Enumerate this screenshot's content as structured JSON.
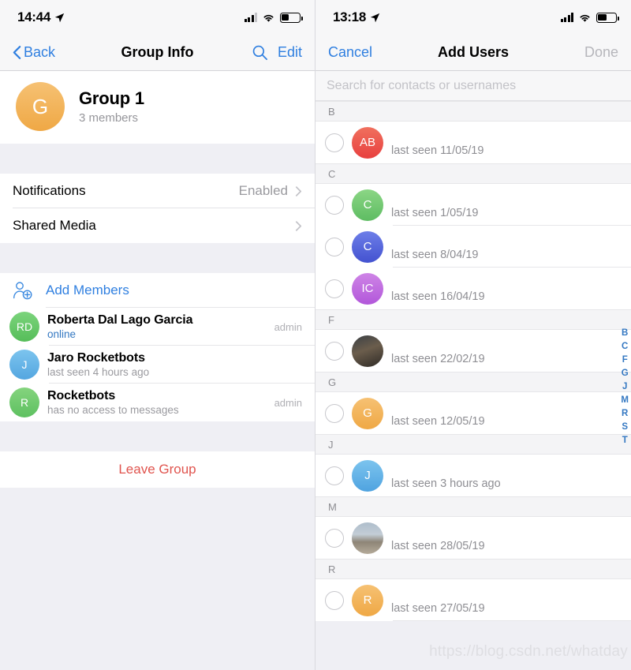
{
  "colors": {
    "accent_blue": "#2F7FE0",
    "index_blue": "#3478C2",
    "destructive_red": "#E0544E",
    "group_avatar": "#F2B156",
    "panel_bg": "#EFEFF4",
    "nav_bg": "#F7F7F8"
  },
  "left": {
    "status": {
      "time": "14:44",
      "location_icon": "location-arrow",
      "signal_bars": 2,
      "wifi_icon": "wifi",
      "battery_icon": "battery-half"
    },
    "nav": {
      "back_label": "Back",
      "back_icon": "chevron-left-icon",
      "title": "Group Info",
      "search_icon": "search-icon",
      "edit_label": "Edit"
    },
    "group": {
      "avatar_initial": "G",
      "avatar_color": "#F2B156",
      "name": "Group 1",
      "members_count": "3 members"
    },
    "settings": [
      {
        "label": "Notifications",
        "value": "Enabled",
        "chevron": "chevron-right-icon"
      },
      {
        "label": "Shared Media",
        "value": "",
        "chevron": "chevron-right-icon"
      }
    ],
    "add_members": {
      "icon": "add-person-icon",
      "label": "Add Members"
    },
    "members": [
      {
        "initials": "RD",
        "color": "#63C766",
        "name": "Roberta Dal Lago Garcia",
        "status": "online",
        "status_type": "online",
        "badge": "admin"
      },
      {
        "initials": "J",
        "color": "#63B3E8",
        "name": "Jaro Rocketbots",
        "status": "last seen 4 hours ago",
        "status_type": "offline",
        "badge": ""
      },
      {
        "initials": "R",
        "color": "#6DC96A",
        "name": "Rocketbots",
        "status": "has no access to messages",
        "status_type": "offline",
        "badge": "admin"
      }
    ],
    "leave_label": "Leave Group"
  },
  "right": {
    "status": {
      "time": "13:18",
      "location_icon": "location-arrow",
      "signal_bars": 4,
      "wifi_icon": "wifi",
      "battery_icon": "battery-half"
    },
    "nav": {
      "cancel_label": "Cancel",
      "title": "Add Users",
      "done_label": "Done"
    },
    "search": {
      "placeholder": "Search for contacts or usernames",
      "value": ""
    },
    "sections": [
      {
        "letter": "B",
        "contacts": [
          {
            "avatar_type": "initials",
            "initials": "AB",
            "color": "#EE5F55",
            "name": "",
            "subtitle": "last seen 11/05/19",
            "checked": false
          }
        ]
      },
      {
        "letter": "C",
        "contacts": [
          {
            "avatar_type": "initials",
            "initials": "C",
            "color": "#73C96E",
            "name": "",
            "subtitle": "last seen 1/05/19",
            "checked": false
          },
          {
            "avatar_type": "initials",
            "initials": "C",
            "color": "#5566DE",
            "name": "",
            "subtitle": "last seen 8/04/19",
            "checked": false
          },
          {
            "avatar_type": "initials",
            "initials": "IC",
            "color": "#C06BE0",
            "name": "",
            "subtitle": "last seen 16/04/19",
            "checked": false
          }
        ]
      },
      {
        "letter": "F",
        "contacts": [
          {
            "avatar_type": "photo",
            "photo_style": "photo-a",
            "initials": "",
            "color": "",
            "name": "",
            "subtitle": "last seen 22/02/19",
            "checked": false
          }
        ]
      },
      {
        "letter": "G",
        "contacts": [
          {
            "avatar_type": "initials",
            "initials": "G",
            "color": "#F2B156",
            "name": "",
            "subtitle": "last seen 12/05/19",
            "checked": false
          }
        ]
      },
      {
        "letter": "J",
        "contacts": [
          {
            "avatar_type": "initials",
            "initials": "J",
            "color": "#62B2E8",
            "name": "",
            "subtitle": "last seen 3 hours ago",
            "checked": false
          }
        ]
      },
      {
        "letter": "M",
        "contacts": [
          {
            "avatar_type": "photo",
            "photo_style": "photo-b",
            "initials": "",
            "color": "",
            "name": "",
            "subtitle": "last seen 28/05/19",
            "checked": false
          }
        ]
      },
      {
        "letter": "R",
        "contacts": [
          {
            "avatar_type": "initials",
            "initials": "R",
            "color": "#F2B156",
            "name": "",
            "subtitle": "last seen 27/05/19",
            "checked": false
          }
        ]
      }
    ],
    "index_letters": [
      "B",
      "C",
      "F",
      "G",
      "J",
      "M",
      "R",
      "S",
      "T"
    ]
  },
  "watermark": "https://blog.csdn.net/whatday"
}
